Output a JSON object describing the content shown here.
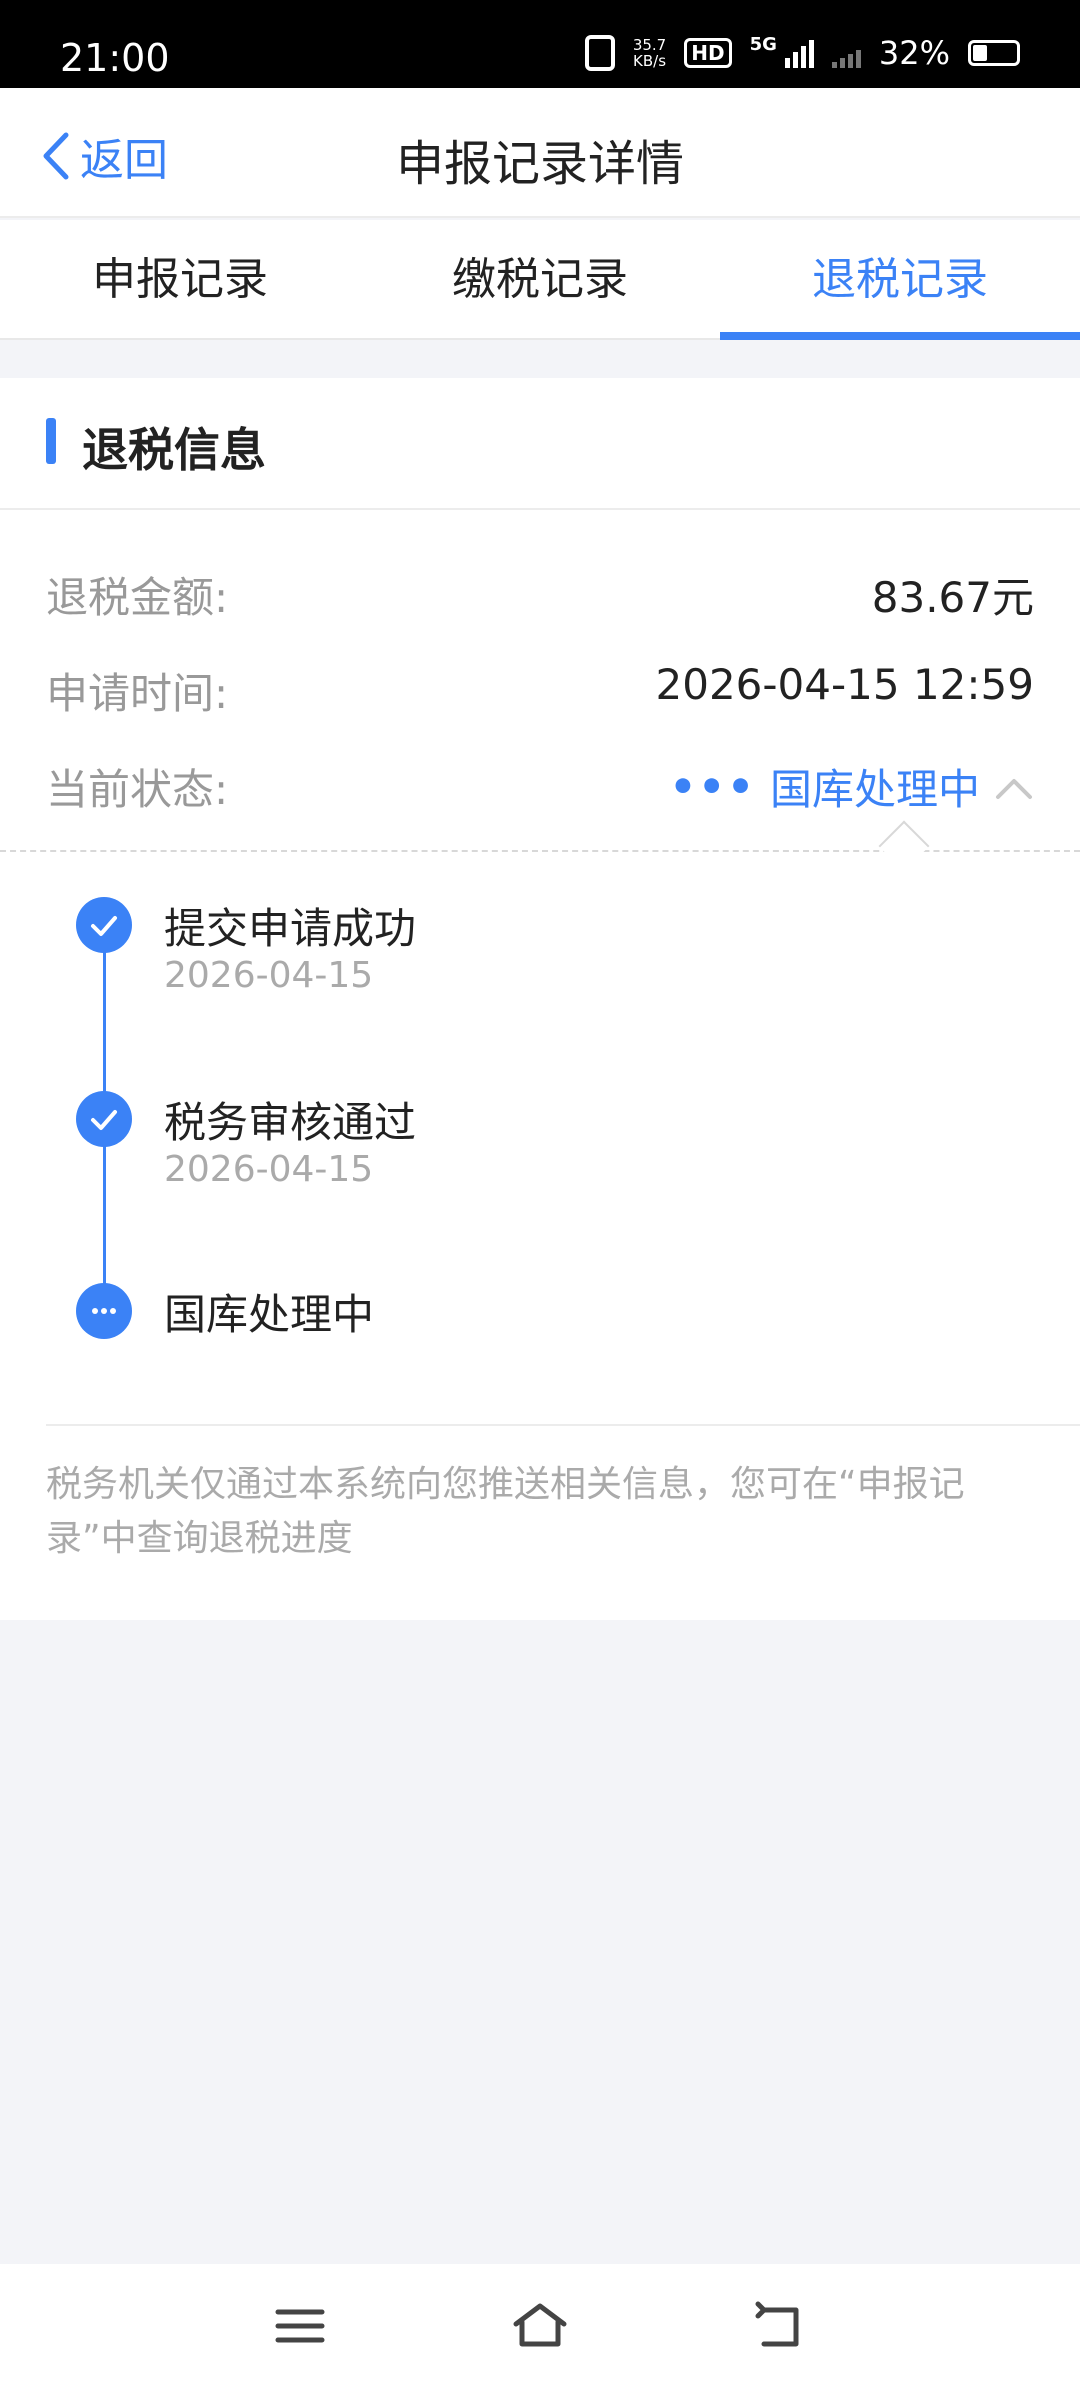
{
  "status_bar": {
    "time": "21:00",
    "speed_top": "35.7",
    "speed_bottom": "KB/s",
    "hd": "HD",
    "net": "5G",
    "battery": "32%"
  },
  "header": {
    "back_label": "返回",
    "title": "申报记录详情"
  },
  "tabs": [
    {
      "label": "申报记录",
      "active": false
    },
    {
      "label": "缴税记录",
      "active": false
    },
    {
      "label": "退税记录",
      "active": true
    }
  ],
  "section": {
    "title": "退税信息"
  },
  "fields": {
    "amount": {
      "label": "退税金额:",
      "value": "83.67元"
    },
    "time": {
      "label": "申请时间:",
      "value": "2026-04-15 12:59"
    },
    "status": {
      "label": "当前状态:",
      "dots": "•••",
      "value": "国库处理中"
    }
  },
  "timeline": [
    {
      "title": "提交申请成功",
      "date": "2026-04-15",
      "state": "done"
    },
    {
      "title": "税务审核通过",
      "date": "2026-04-15",
      "state": "done"
    },
    {
      "title": "国库处理中",
      "date": "",
      "state": "in-progress"
    }
  ],
  "note": "税务机关仅通过本系统向您推送相关信息，您可在“申报记录”中查询退税进度",
  "colors": {
    "accent": "#3b82f6",
    "muted": "#999999",
    "background": "#f3f4f8"
  },
  "nav_icons": [
    "menu-icon",
    "home-icon",
    "back-icon"
  ]
}
